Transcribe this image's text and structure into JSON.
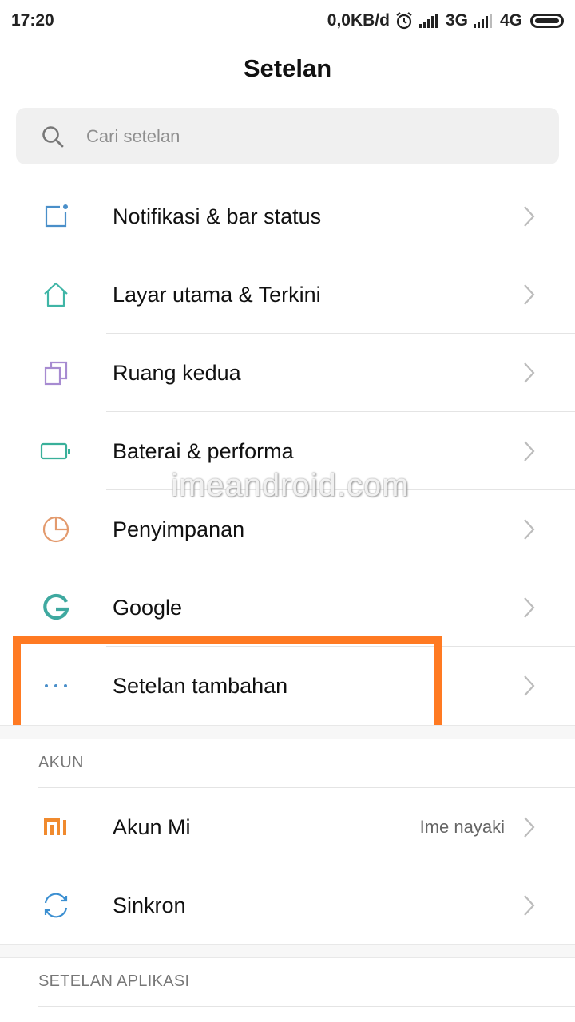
{
  "status_bar": {
    "time": "17:20",
    "speed": "0,0KB/d",
    "net1": "3G",
    "net2": "4G"
  },
  "header": {
    "title": "Setelan",
    "search_placeholder": "Cari setelan"
  },
  "items": [
    {
      "label": "Notifikasi & bar status",
      "icon": "notification-square-icon",
      "color": "#4a8fc9"
    },
    {
      "label": "Layar utama & Terkini",
      "icon": "home-icon",
      "color": "#3fb5a6"
    },
    {
      "label": "Ruang kedua",
      "icon": "dual-space-icon",
      "color": "#a78bd1"
    },
    {
      "label": "Baterai & performa",
      "icon": "battery-icon",
      "color": "#39b09a"
    },
    {
      "label": "Penyimpanan",
      "icon": "storage-pie-icon",
      "color": "#e39a6d"
    },
    {
      "label": "Google",
      "icon": "google-icon",
      "color": "#3fa9a0"
    },
    {
      "label": "Setelan tambahan",
      "icon": "more-dots-icon",
      "color": "#4a8fc9"
    }
  ],
  "sections": {
    "akun": {
      "title": "AKUN",
      "items": [
        {
          "label": "Akun Mi",
          "value": "Ime nayaki",
          "icon": "mi-logo-icon",
          "color": "#f08a2e"
        },
        {
          "label": "Sinkron",
          "icon": "sync-icon",
          "color": "#3b8fd1"
        }
      ]
    },
    "aplikasi": {
      "title": "SETELAN APLIKASI"
    }
  },
  "watermark": "imeandroid.com",
  "highlight_color": "#ff7a22"
}
